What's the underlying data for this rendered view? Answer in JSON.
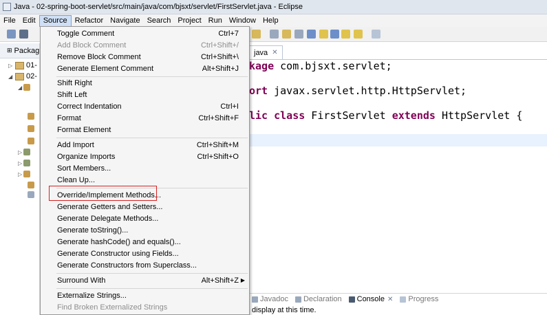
{
  "window": {
    "title": "Java - 02-spring-boot-servlet/src/main/java/com/bjsxt/servlet/FirstServlet.java - Eclipse"
  },
  "menubar": [
    "File",
    "Edit",
    "Source",
    "Refactor",
    "Navigate",
    "Search",
    "Project",
    "Run",
    "Window",
    "Help"
  ],
  "left_pane": {
    "tab_label": "Packag",
    "tree": [
      "01-",
      "02-"
    ]
  },
  "editor": {
    "tab_label": "java",
    "code": {
      "line1_kw": "kage",
      "line1_rest": " com.bjsxt.servlet;",
      "line2_kw": "ort",
      "line2_rest": " javax.servlet.http.HttpServlet;",
      "line3_kw": "lic class",
      "line3_mid": " FirstServlet ",
      "line3_kw2": "extends",
      "line3_rest": " HttpServlet {"
    }
  },
  "bottom_pane": {
    "tabs": [
      "Javadoc",
      "Declaration",
      "Console",
      "Progress"
    ],
    "message": "display at this time."
  },
  "source_menu": {
    "group1": [
      {
        "label": "Toggle Comment",
        "shortcut": "Ctrl+7",
        "disabled": false
      },
      {
        "label": "Add Block Comment",
        "shortcut": "Ctrl+Shift+/",
        "disabled": true
      },
      {
        "label": "Remove Block Comment",
        "shortcut": "Ctrl+Shift+\\",
        "disabled": false
      },
      {
        "label": "Generate Element Comment",
        "shortcut": "Alt+Shift+J",
        "disabled": false
      }
    ],
    "group2": [
      {
        "label": "Shift Right",
        "shortcut": ""
      },
      {
        "label": "Shift Left",
        "shortcut": ""
      },
      {
        "label": "Correct Indentation",
        "shortcut": "Ctrl+I"
      },
      {
        "label": "Format",
        "shortcut": "Ctrl+Shift+F"
      },
      {
        "label": "Format Element",
        "shortcut": ""
      }
    ],
    "group3": [
      {
        "label": "Add Import",
        "shortcut": "Ctrl+Shift+M"
      },
      {
        "label": "Organize Imports",
        "shortcut": "Ctrl+Shift+O"
      },
      {
        "label": "Sort Members...",
        "shortcut": ""
      },
      {
        "label": "Clean Up...",
        "shortcut": ""
      }
    ],
    "group4": [
      {
        "label": "Override/Implement Methods...",
        "shortcut": ""
      },
      {
        "label": "Generate Getters and Setters...",
        "shortcut": ""
      },
      {
        "label": "Generate Delegate Methods...",
        "shortcut": ""
      },
      {
        "label": "Generate toString()...",
        "shortcut": ""
      },
      {
        "label": "Generate hashCode() and equals()...",
        "shortcut": ""
      },
      {
        "label": "Generate Constructor using Fields...",
        "shortcut": ""
      },
      {
        "label": "Generate Constructors from Superclass...",
        "shortcut": ""
      }
    ],
    "group5": [
      {
        "label": "Surround With",
        "shortcut": "Alt+Shift+Z"
      }
    ],
    "group6": [
      {
        "label": "Externalize Strings...",
        "shortcut": "",
        "disabled": false
      },
      {
        "label": "Find Broken Externalized Strings",
        "shortcut": "",
        "disabled": true
      }
    ]
  },
  "colors": {
    "keyword": "#7f0055",
    "highlight_box": "#d62020",
    "menu_active": "#cfe0f6"
  }
}
